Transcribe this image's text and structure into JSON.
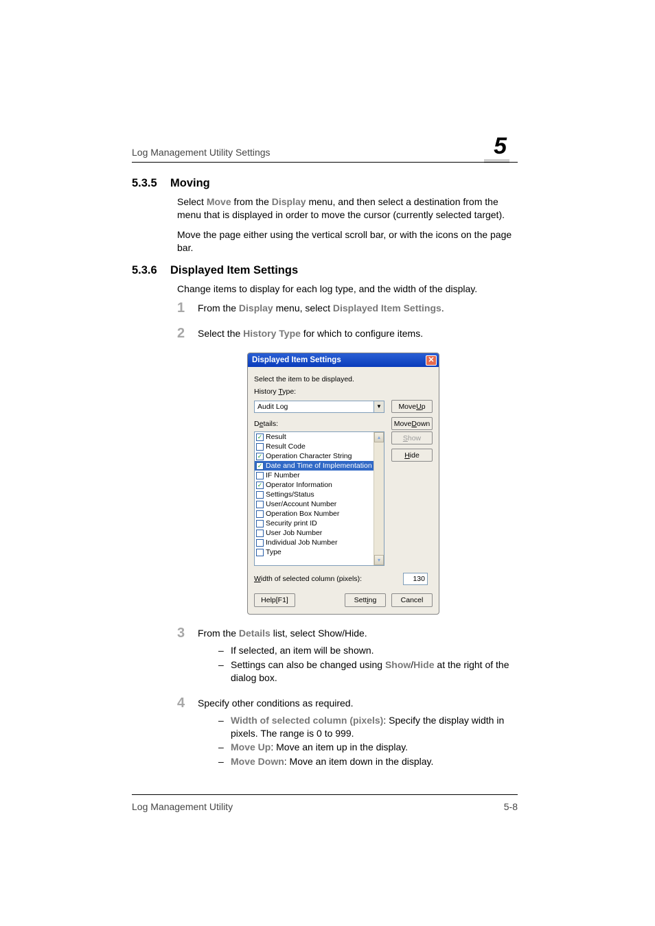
{
  "header": {
    "running_head": "Log Management Utility Settings",
    "chapter_number": "5"
  },
  "section_535": {
    "number": "5.3.5",
    "title": "Moving",
    "para1_a": "Select ",
    "para1_move": "Move",
    "para1_b": " from the ",
    "para1_display": "Display",
    "para1_c": " menu, and then select a destination from the menu that is displayed in order to move the cursor (currently selected target).",
    "para2": "Move the page either using the vertical scroll bar, or with the icons on the page bar."
  },
  "section_536": {
    "number": "5.3.6",
    "title": "Displayed Item Settings",
    "intro": "Change items to display for each log type, and the width of the display.",
    "step1_a": "From the ",
    "step1_display": "Display",
    "step1_b": " menu, select ",
    "step1_dis": "Displayed Item Settings",
    "step1_c": ".",
    "step2_a": "Select the ",
    "step2_ht": "History Type",
    "step2_b": " for which to configure items.",
    "step3_a": "From the ",
    "step3_details": "Details",
    "step3_b": " list, select Show/Hide.",
    "step3_sub1": "If selected, an item will be shown.",
    "step3_sub2_a": "Settings can also be changed using ",
    "step3_sub2_show": "Show",
    "step3_sub2_slash": "/",
    "step3_sub2_hide": "Hide",
    "step3_sub2_b": " at the right of the dialog box.",
    "step4": "Specify other conditions as required.",
    "step4_sub1_lbl": "Width of selected column (pixels)",
    "step4_sub1_b": ": Specify the display width in pixels. The range is 0 to 999.",
    "step4_sub2_lbl": "Move Up",
    "step4_sub2_b": ": Move an item up in the display.",
    "step4_sub3_lbl": "Move Down",
    "step4_sub3_b": ": Move an item down in the display."
  },
  "dialog": {
    "title": "Displayed Item Settings",
    "instruction": "Select the item to be displayed.",
    "history_label": "History Type:",
    "history_label_under": "T",
    "history_value": "Audit Log",
    "move_up": "Move Up",
    "move_up_under": "U",
    "details_label": "Details:",
    "details_label_under": "e",
    "move_down": "Move Down",
    "move_down_under": "D",
    "show": "Show",
    "show_under": "S",
    "hide": "Hide",
    "hide_under": "H",
    "width_label": "Width of selected column (pixels):",
    "width_label_under": "W",
    "width_value": "130",
    "help": "Help[F1]",
    "setting": "Setting",
    "setting_under": "i",
    "cancel": "Cancel",
    "items": [
      {
        "label": "Result",
        "checked": true
      },
      {
        "label": "Result Code",
        "checked": false
      },
      {
        "label": "Operation Character String",
        "checked": true
      },
      {
        "label": "Date and Time of Implementation",
        "checked": true,
        "selected": true
      },
      {
        "label": "IF Number",
        "checked": false
      },
      {
        "label": "Operator Information",
        "checked": true
      },
      {
        "label": "Settings/Status",
        "checked": false
      },
      {
        "label": "User/Account Number",
        "checked": false
      },
      {
        "label": "Operation Box Number",
        "checked": false
      },
      {
        "label": "Security print ID",
        "checked": false
      },
      {
        "label": "User Job Number",
        "checked": false
      },
      {
        "label": "Individual Job Number",
        "checked": false
      },
      {
        "label": "Type",
        "checked": false
      }
    ]
  },
  "footer": {
    "left": "Log Management Utility",
    "right": "5-8"
  }
}
